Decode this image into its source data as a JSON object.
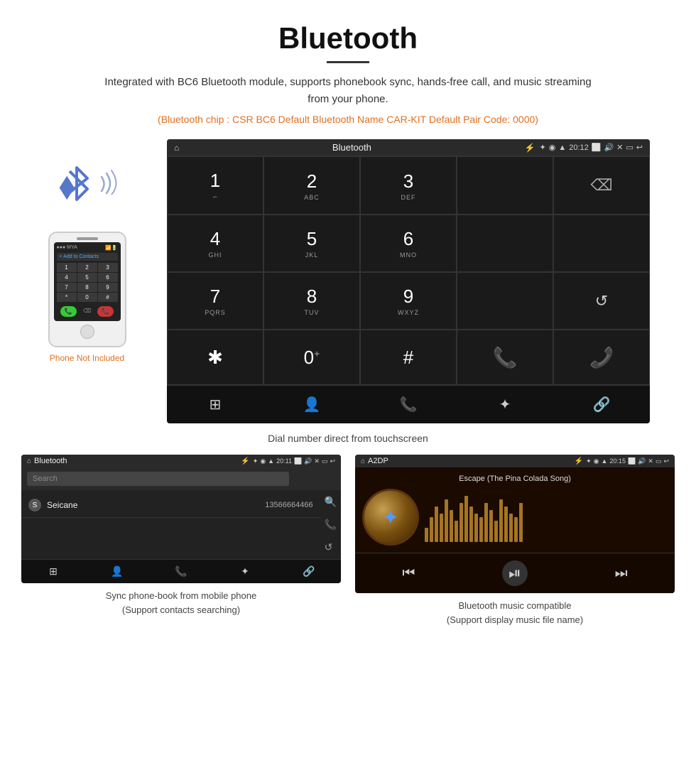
{
  "page": {
    "title": "Bluetooth",
    "subtitle": "Integrated with BC6 Bluetooth module, supports phonebook sync, hands-free call, and music streaming from your phone.",
    "info_line": "(Bluetooth chip : CSR BC6    Default Bluetooth Name CAR-KIT    Default Pair Code: 0000)",
    "dial_caption": "Dial number direct from touchscreen",
    "phonebook_caption": "Sync phone-book from mobile phone\n(Support contacts searching)",
    "music_caption": "Bluetooth music compatible\n(Support display music file name)"
  },
  "statusbar": {
    "title": "Bluetooth",
    "time": "20:12",
    "home_icon": "⌂",
    "usb_icon": "⚡",
    "bt_icon": "✦",
    "gps_icon": "◉",
    "signal_icon": "▲",
    "camera_icon": "📷",
    "volume_icon": "🔊",
    "close_icon": "✕",
    "window_icon": "▭",
    "back_icon": "↩"
  },
  "dialpad": {
    "keys": [
      {
        "num": "1",
        "sub": "∽"
      },
      {
        "num": "2",
        "sub": "ABC"
      },
      {
        "num": "3",
        "sub": "DEF"
      },
      {
        "num": "",
        "sub": ""
      },
      {
        "num": "⌫",
        "sub": ""
      },
      {
        "num": "4",
        "sub": "GHI"
      },
      {
        "num": "5",
        "sub": "JKL"
      },
      {
        "num": "6",
        "sub": "MNO"
      },
      {
        "num": "",
        "sub": ""
      },
      {
        "num": "",
        "sub": ""
      },
      {
        "num": "7",
        "sub": "PQRS"
      },
      {
        "num": "8",
        "sub": "TUV"
      },
      {
        "num": "9",
        "sub": "WXYZ"
      },
      {
        "num": "",
        "sub": ""
      },
      {
        "num": "↺",
        "sub": ""
      },
      {
        "num": "*",
        "sub": ""
      },
      {
        "num": "0",
        "sub": "+"
      },
      {
        "num": "#",
        "sub": ""
      },
      {
        "num": "📞",
        "sub": "green"
      },
      {
        "num": "📞",
        "sub": "red"
      }
    ],
    "bottom_nav": [
      "⊞",
      "👤",
      "📞",
      "✦",
      "🔗"
    ]
  },
  "phonebook": {
    "statusbar_title": "Bluetooth",
    "statusbar_time": "20:11",
    "search_placeholder": "Search",
    "contacts": [
      {
        "letter": "S",
        "name": "Seicane",
        "number": "13566664466"
      }
    ],
    "bottom_nav": [
      "⊞",
      "👤",
      "📞",
      "✦",
      "🔗"
    ]
  },
  "music": {
    "statusbar_title": "A2DP",
    "statusbar_time": "20:15",
    "song_title": "Escape (The Pina Colada Song)",
    "controls": [
      "⏮",
      "⏯",
      "⏭"
    ],
    "viz_heights": [
      20,
      35,
      50,
      40,
      60,
      45,
      30,
      55,
      65,
      50,
      40,
      35,
      55,
      45,
      30,
      60,
      50,
      40,
      35,
      55
    ]
  },
  "phone_device": {
    "not_included": "Phone Not Included",
    "numpad_keys": [
      "1",
      "2",
      "3",
      "4",
      "5",
      "6",
      "7",
      "8",
      "9",
      "*",
      "0",
      "#"
    ],
    "add_contact_label": "+ Add to Contacts"
  }
}
